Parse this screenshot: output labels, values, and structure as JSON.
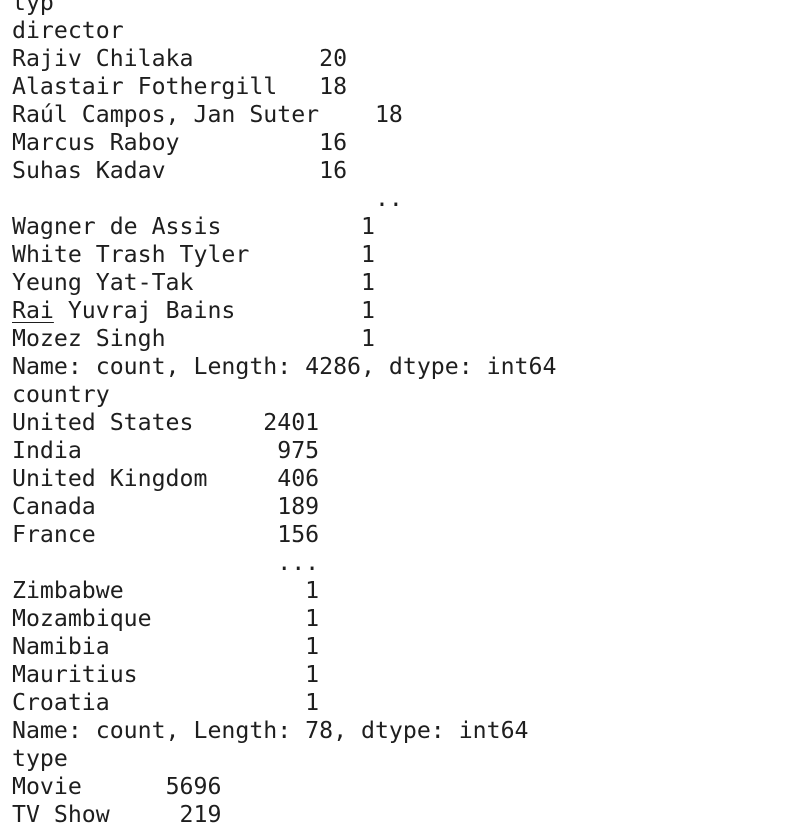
{
  "output": {
    "cut_top_line": "typ",
    "director": {
      "header": "director",
      "rows": [
        {
          "label": "Rajiv Chilaka",
          "value": "20"
        },
        {
          "label": "Alastair Fothergill",
          "value": "18"
        },
        {
          "label": "Raúl Campos, Jan Suter",
          "value": "18"
        },
        {
          "label": "Marcus Raboy",
          "value": "16"
        },
        {
          "label": "Suhas Kadav",
          "value": "16"
        },
        {
          "label": "",
          "value": ".."
        },
        {
          "label": "Wagner de Assis",
          "value": " 1"
        },
        {
          "label": "White Trash Tyler",
          "value": " 1"
        },
        {
          "label": "Yeung Yat-Tak",
          "value": " 1"
        },
        {
          "label": "Rai Yuvraj Bains",
          "value": " 1",
          "underline_prefix": "Rai",
          "rest": " Yuvraj Bains"
        },
        {
          "label": "Mozez Singh",
          "value": " 1"
        }
      ],
      "footer": "Name: count, Length: 4286, dtype: int64"
    },
    "country": {
      "header": "country",
      "rows": [
        {
          "label": "United States",
          "value": "2401"
        },
        {
          "label": "India",
          "value": " 975"
        },
        {
          "label": "United Kingdom",
          "value": " 406"
        },
        {
          "label": "Canada",
          "value": " 189"
        },
        {
          "label": "France",
          "value": " 156"
        },
        {
          "label": "",
          "value": " ..."
        },
        {
          "label": "Zimbabwe",
          "value": "   1"
        },
        {
          "label": "Mozambique",
          "value": "   1"
        },
        {
          "label": "Namibia",
          "value": "   1"
        },
        {
          "label": "Mauritius",
          "value": "   1"
        },
        {
          "label": "Croatia",
          "value": "   1"
        }
      ],
      "footer": "Name: count, Length: 78, dtype: int64"
    },
    "type": {
      "header": "type",
      "rows": [
        {
          "label": "Movie",
          "value": "5696"
        },
        {
          "label": "TV Show",
          "value": " 219"
        }
      ]
    }
  }
}
